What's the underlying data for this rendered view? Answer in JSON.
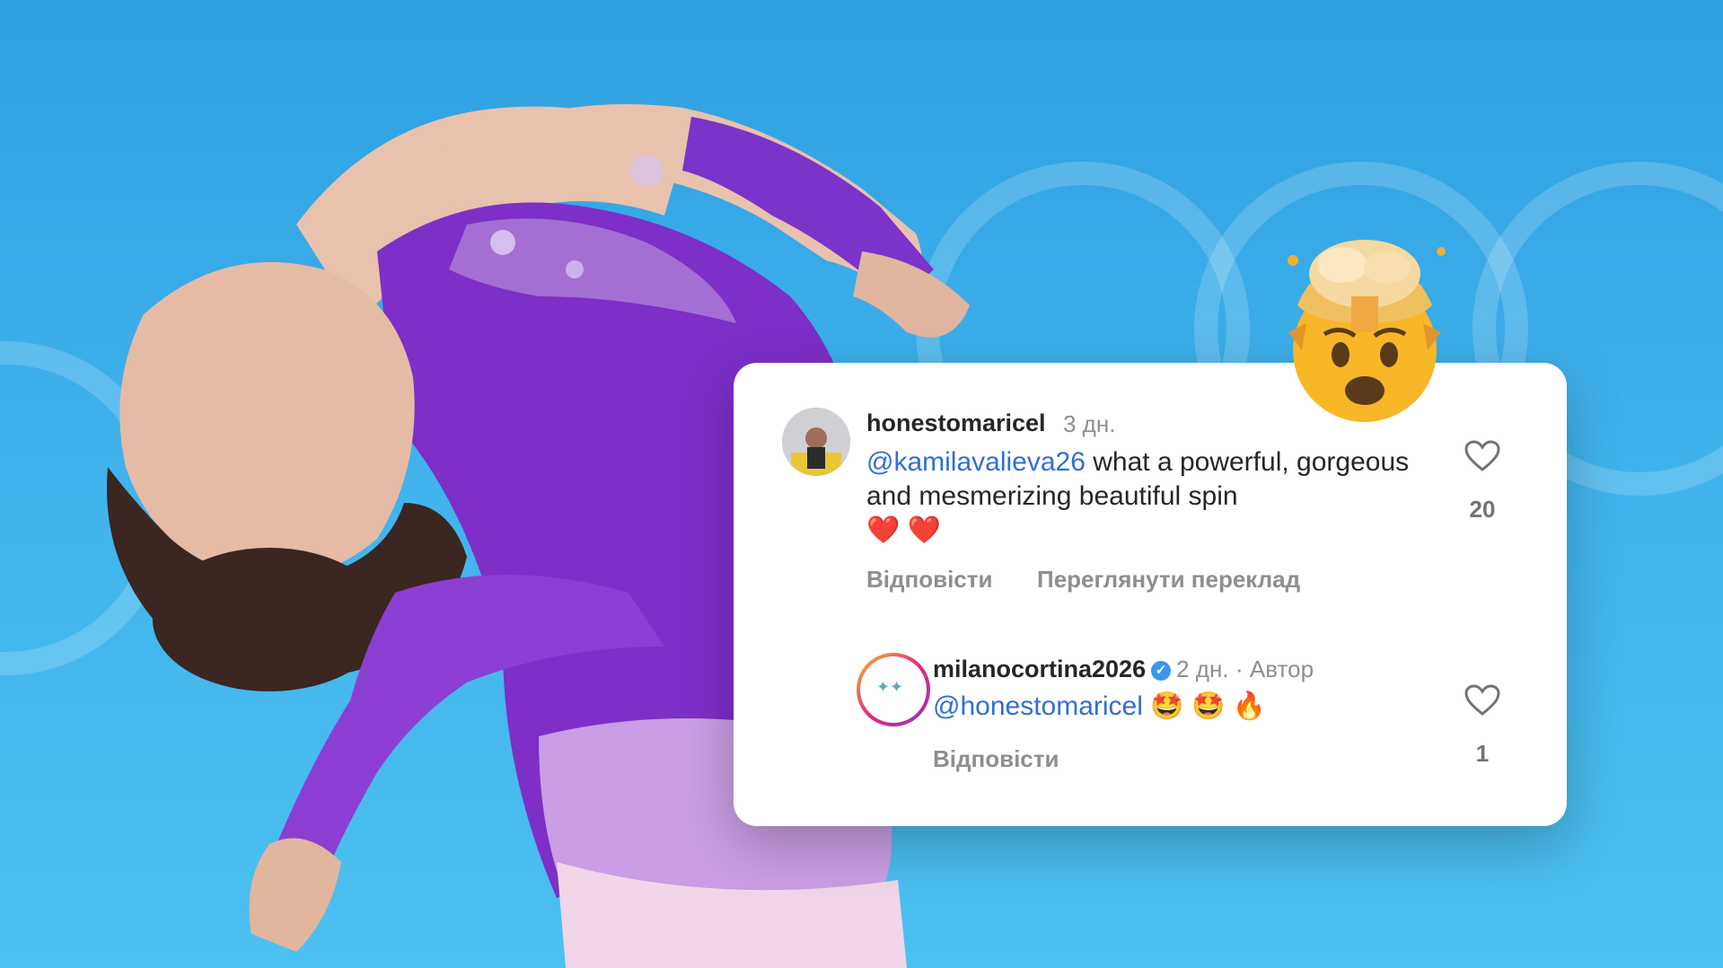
{
  "comment1": {
    "username": "honestomaricel",
    "time": "3 дн.",
    "mention": "@kamilavalieva26",
    "text": " what a powerful, gorgeous and mesmerizing beautiful spin",
    "emoji": "❤️ ❤️",
    "reply_label": "Відповісти",
    "translate_label": "Переглянути переклад",
    "likes": "20"
  },
  "comment2": {
    "username": "milanocortina2026",
    "time": "2 дн.",
    "author_label": "· Автор",
    "mention": "@honestomaricel",
    "emoji": "🤩 🤩 🔥",
    "reply_label": "Відповісти",
    "likes": "1"
  },
  "icons": {
    "heart": "heart-icon",
    "verified": "verified-badge-icon",
    "exploding_head": "exploding-head-emoji"
  }
}
